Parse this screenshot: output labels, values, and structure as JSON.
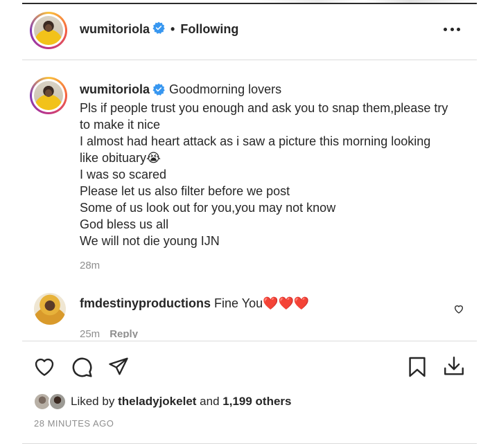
{
  "post": {
    "username": "wumitoriola",
    "verified": true,
    "follow_status": "Following",
    "dot": "•"
  },
  "caption": {
    "username": "wumitoriola",
    "lines": [
      "Goodmorning lovers",
      "Pls if people trust you enough and ask you to snap them,please try",
      "to make it nice",
      "I almost had heart attack as i saw a picture this morning looking",
      "like obituary😭",
      "I was so scared",
      "Please let us also filter before we post",
      "Some of us look out for you,you may not know",
      "God bless us all",
      "We will not die young IJN"
    ],
    "time": "28m"
  },
  "comment": {
    "username": "fmdestinyproductions",
    "text": "Fine You❤️❤️❤️",
    "time": "25m",
    "reply_label": "Reply"
  },
  "actions": {
    "icons": [
      "heart-icon",
      "comment-icon",
      "share-icon",
      "bookmark-icon",
      "download-icon"
    ]
  },
  "likes": {
    "prefix": "Liked by",
    "user": "theladyjokelet",
    "connector": "and",
    "others": "1,199 others"
  },
  "timestamp": "28 MINUTES AGO",
  "colors": {
    "text": "#262626",
    "secondary": "#8e8e8e",
    "verified": "#3897f0",
    "divider": "#dbdbdb",
    "heart_red": "#ed4956"
  }
}
